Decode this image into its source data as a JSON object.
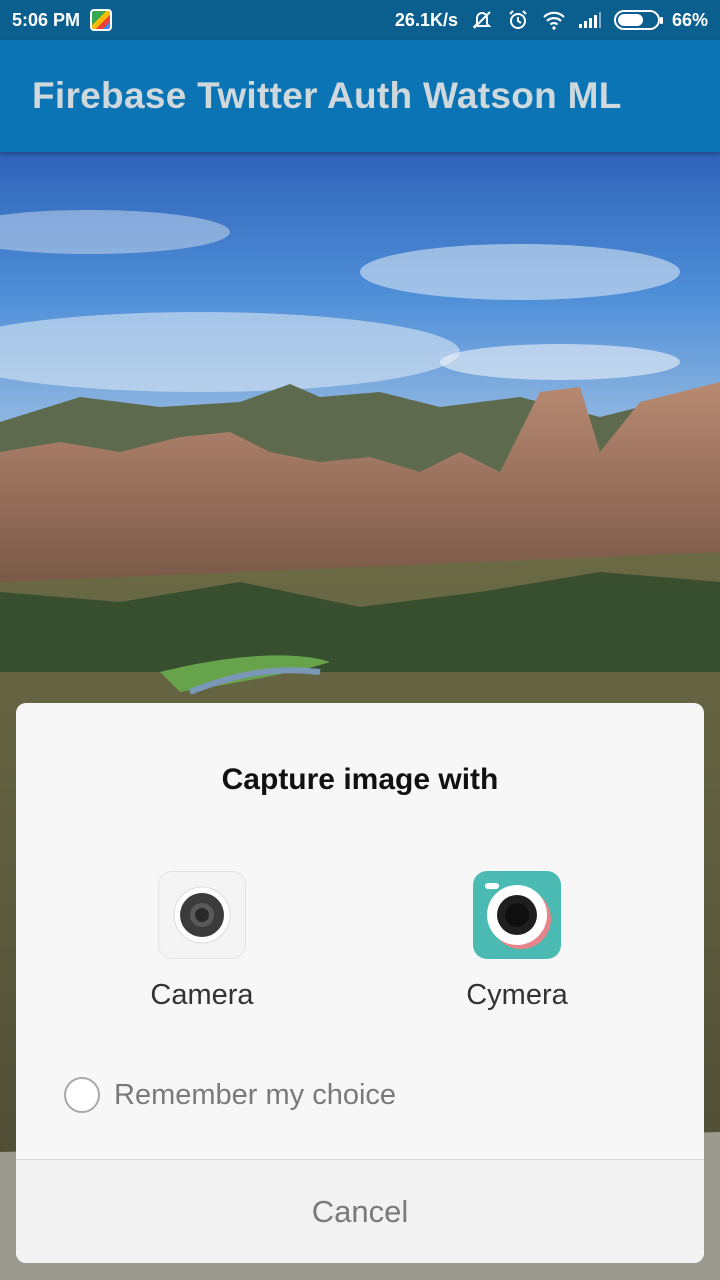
{
  "status_bar": {
    "time": "5:06 PM",
    "net_speed": "26.1K/s",
    "battery": "66%",
    "battery_level": 0.66,
    "icons": [
      "maps-icon",
      "mute-icon",
      "alarm-icon",
      "wifi-icon",
      "signal-icon",
      "battery-icon"
    ]
  },
  "app_bar": {
    "title": "Firebase Twitter Auth Watson ML"
  },
  "dialog": {
    "title": "Capture image with",
    "options": [
      {
        "label": "Camera",
        "icon": "camera-app-icon"
      },
      {
        "label": "Cymera",
        "icon": "cymera-app-icon"
      }
    ],
    "remember_label": "Remember my choice",
    "cancel_label": "Cancel"
  },
  "colors": {
    "status_bar": "#0b5f8f",
    "app_bar": "#0b74b5",
    "cymera_bg": "#4bbab3"
  }
}
